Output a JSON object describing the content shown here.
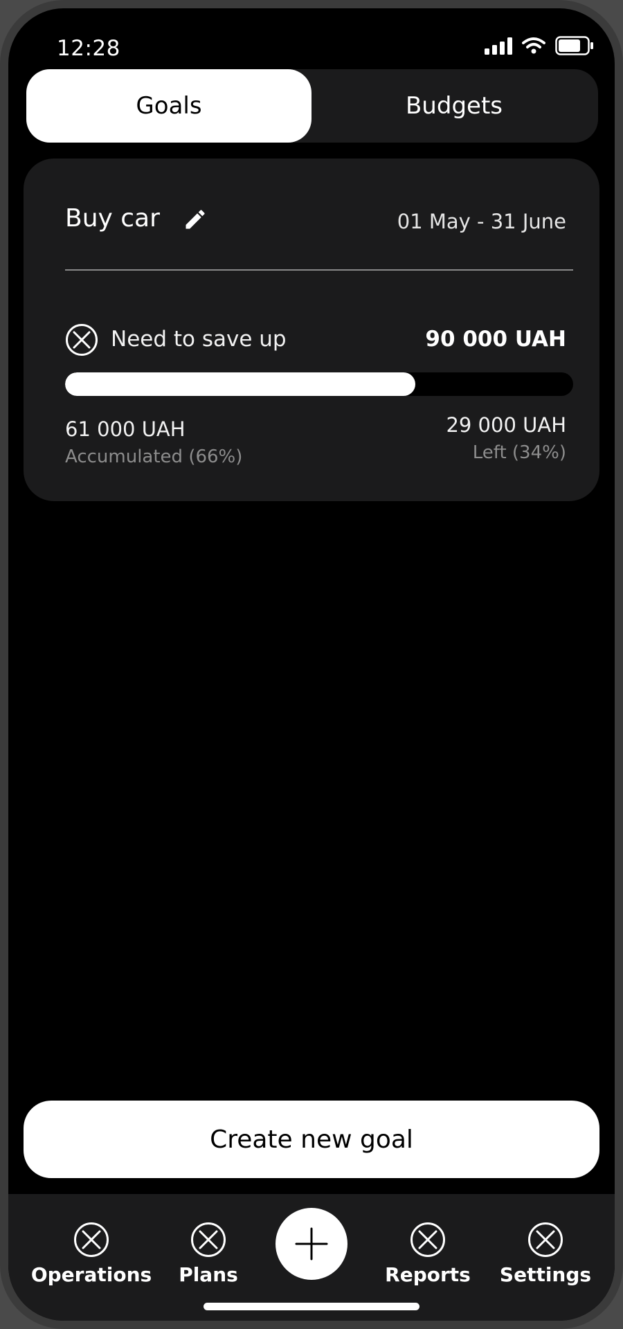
{
  "status_bar": {
    "time": "12:28"
  },
  "tabs": [
    {
      "label": "Goals",
      "active": true
    },
    {
      "label": "Budgets",
      "active": false
    }
  ],
  "goal": {
    "title": "Buy car",
    "dates": "01 May - 31 June",
    "save_label": "Need to save up",
    "target_amount": "90 000 UAH",
    "progress_fraction": 0.69,
    "accumulated_value": "61 000 UAH",
    "accumulated_label": "Accumulated (66%)",
    "left_value": "29 000 UAH",
    "left_label": "Left (34%)"
  },
  "create_button": {
    "label": "Create new goal"
  },
  "nav": {
    "items": [
      {
        "label": "Operations",
        "icon": "x-circle-icon"
      },
      {
        "label": "Plans",
        "icon": "x-circle-icon"
      },
      {
        "label": "Reports",
        "icon": "x-circle-icon"
      },
      {
        "label": "Settings",
        "icon": "x-circle-icon"
      }
    ],
    "add_icon": "plus-icon"
  },
  "colors": {
    "background": "#000000",
    "surface": "#1b1b1c",
    "accent": "#ffffff",
    "muted_text": "#8d8d8d"
  }
}
